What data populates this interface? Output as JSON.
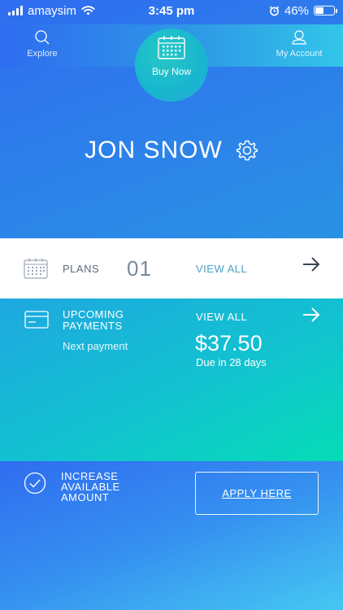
{
  "status_bar": {
    "carrier": "amaysim",
    "time": "3:45 pm",
    "battery": "46%",
    "battery_level": 0.46
  },
  "nav": {
    "explore_label": "Explore",
    "buy_now_label": "Buy Now",
    "account_label": "My Account"
  },
  "user": {
    "name": "JON SNOW"
  },
  "plans": {
    "label": "PLANS",
    "count": "01",
    "view_all": "VIEW ALL"
  },
  "payments": {
    "label": "UPCOMING PAYMENTS",
    "next_label": "Next payment",
    "view_all": "VIEW ALL",
    "amount": "$37.50",
    "due": "Due in 28 days"
  },
  "increase": {
    "label": "INCREASE AVAILABLE AMOUNT",
    "apply_label": "APPLY HERE"
  },
  "colors": {
    "accent": "#2f6df0",
    "teal": "#05dcb6",
    "plans_link": "#4aa0c8"
  },
  "icons": {
    "explore": "search-icon",
    "buy_now": "calendar-icon",
    "account": "user-icon",
    "settings": "gear-icon",
    "plans": "calendar-icon",
    "payments": "credit-card-icon",
    "increase": "check-circle-icon",
    "arrow": "arrow-right-icon"
  }
}
